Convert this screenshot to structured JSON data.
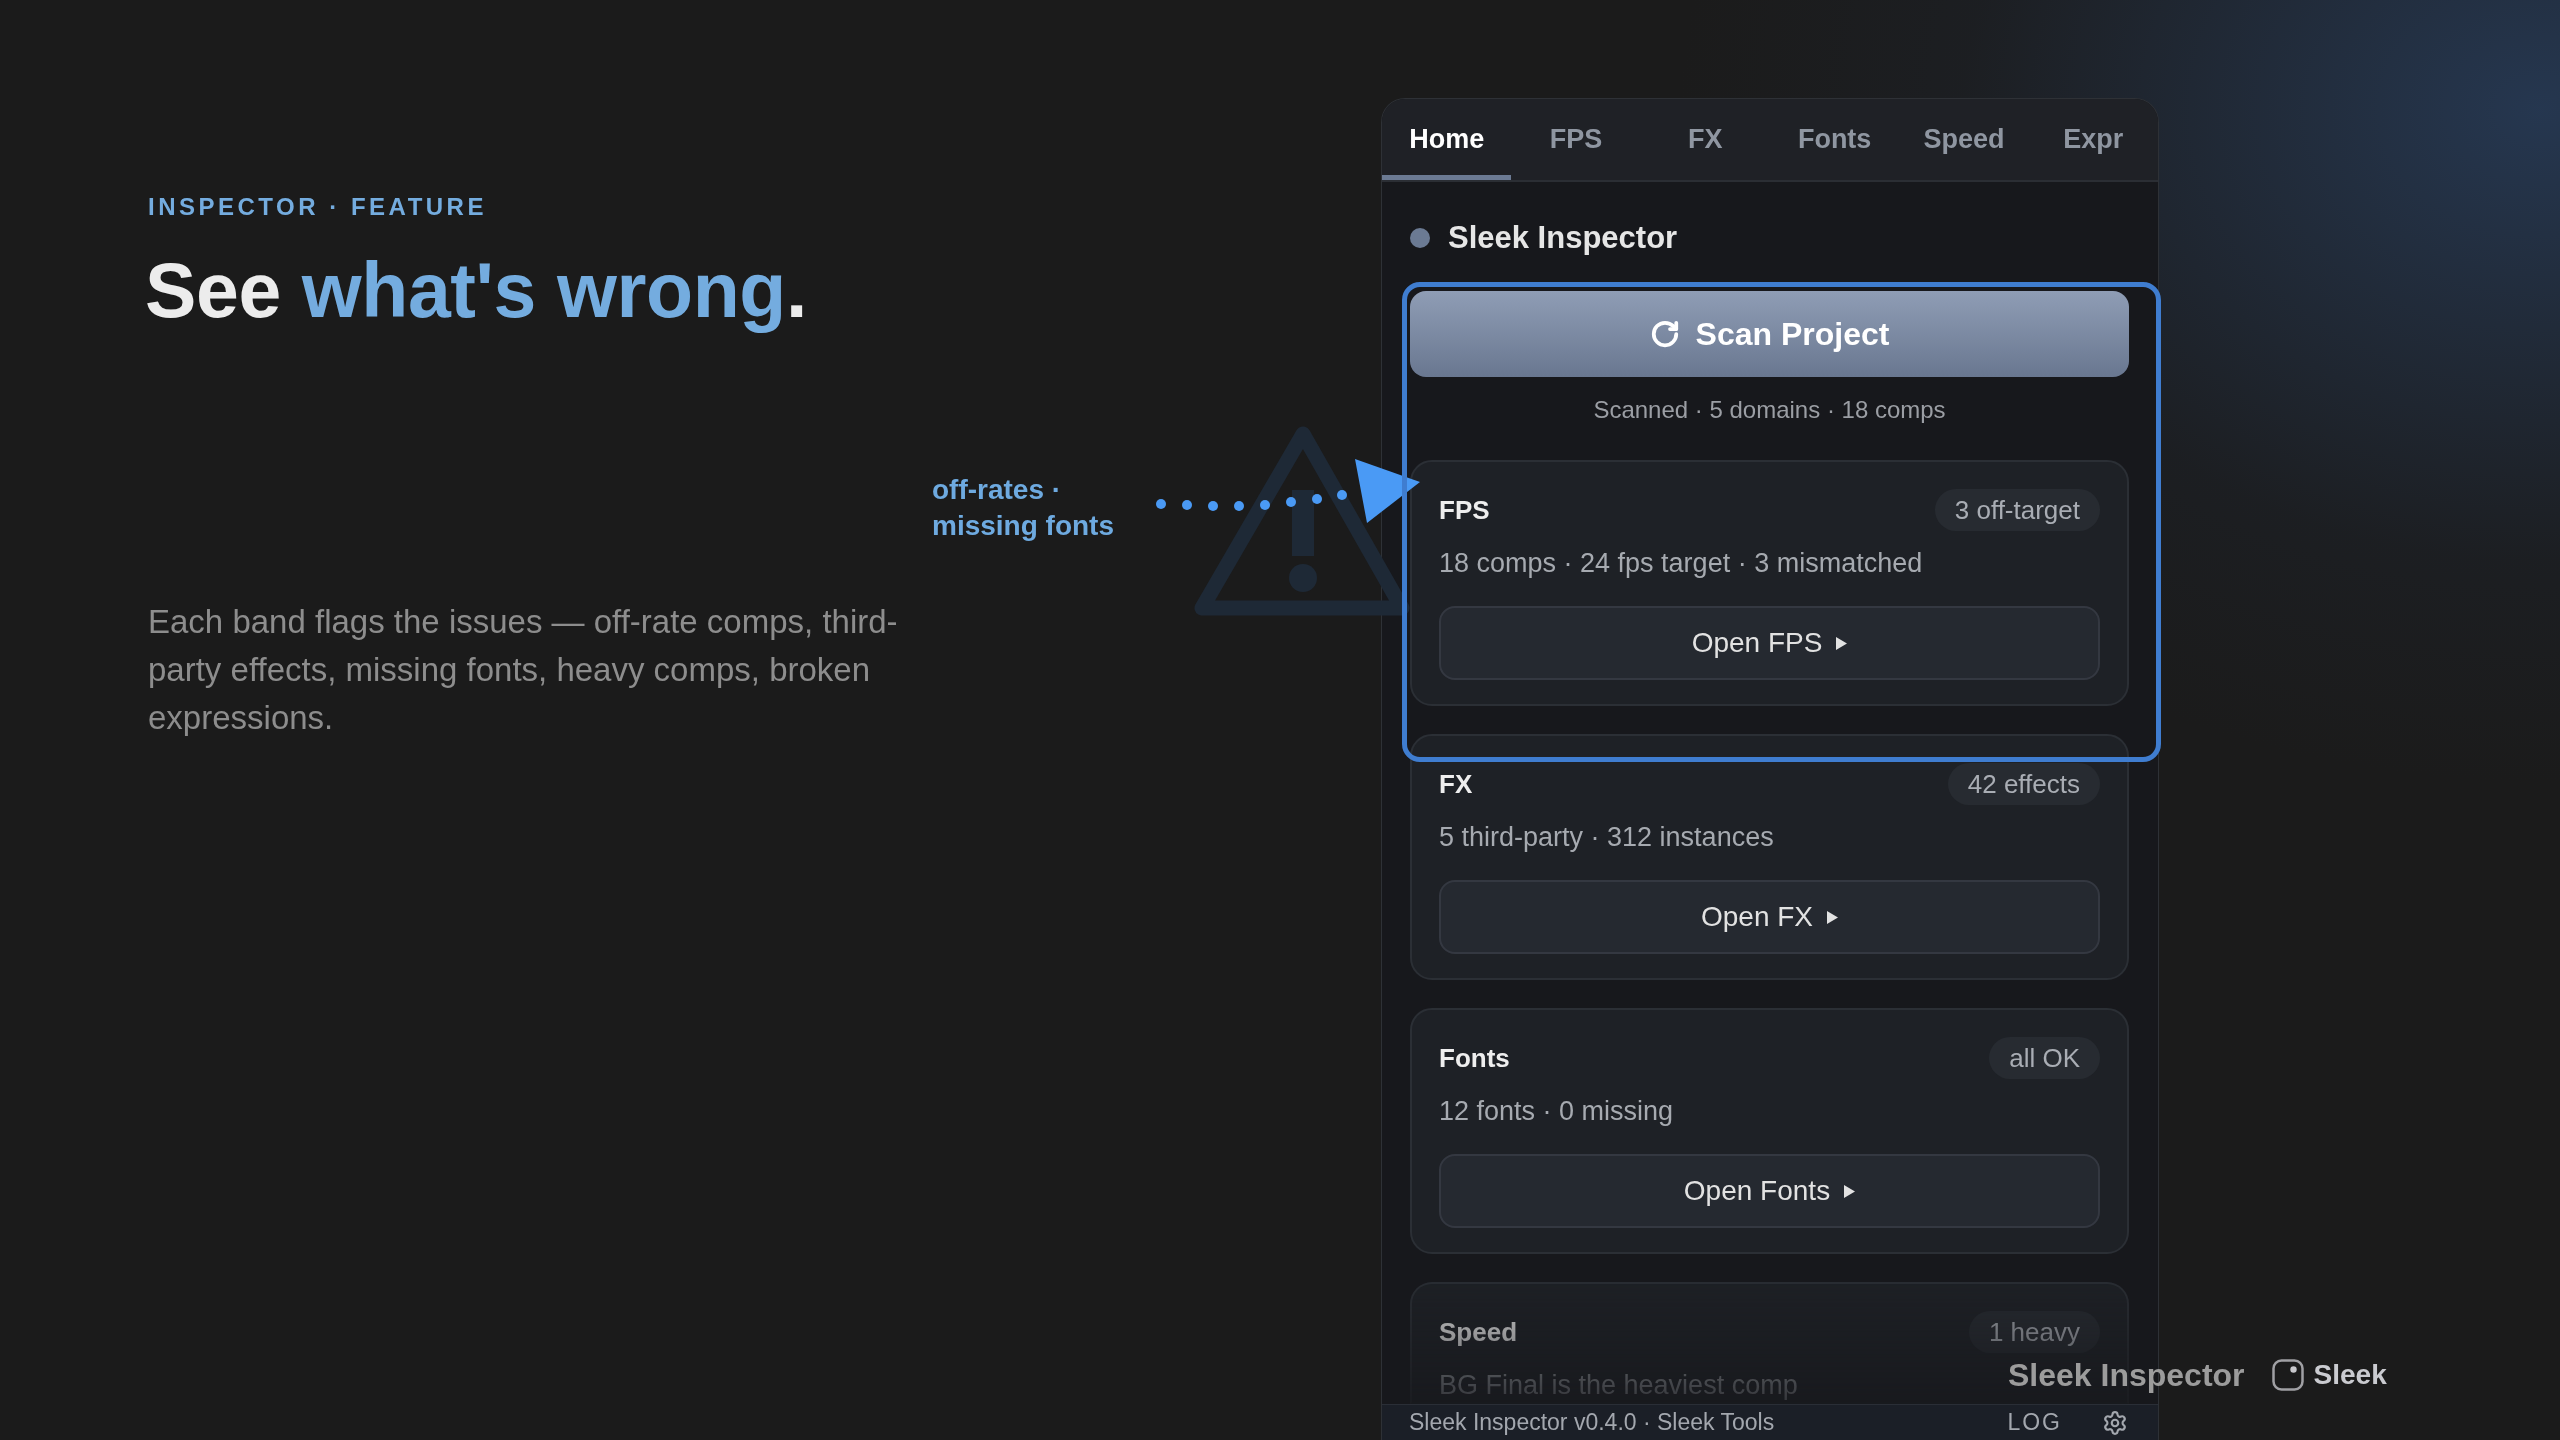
{
  "intro": {
    "eyebrow": "INSPECTOR · FEATURE",
    "headline": [
      {
        "text": "See ",
        "accent": false
      },
      {
        "text": "what's wrong",
        "accent": true
      },
      {
        "text": ".",
        "accent": false
      }
    ],
    "body": "Each band flags the issues — off-rate comps, third-party effects, missing fonts, heavy comps, broken expressions."
  },
  "callout": {
    "text": "off-rates · missing fonts"
  },
  "panel": {
    "tabs": [
      {
        "label": "Home",
        "selected": true
      },
      {
        "label": "FPS",
        "selected": false
      },
      {
        "label": "FX",
        "selected": false
      },
      {
        "label": "Fonts",
        "selected": false
      },
      {
        "label": "Speed",
        "selected": false
      },
      {
        "label": "Expr",
        "selected": false
      }
    ],
    "title": "Sleek Inspector",
    "scan_button": "Scan Project",
    "scan_summary": "Scanned · 5 domains · 18 comps",
    "cards": [
      {
        "title": "FPS",
        "badge": "3 off-target",
        "summary": "18 comps · 24 fps target · 3 mismatched",
        "button": "Open FPS"
      },
      {
        "title": "FX",
        "badge": "42 effects",
        "summary": "5 third-party · 312 instances",
        "button": "Open FX"
      },
      {
        "title": "Fonts",
        "badge": "all OK",
        "summary": "12 fonts · 0 missing",
        "button": "Open Fonts"
      },
      {
        "title": "Speed",
        "badge": "1 heavy",
        "summary": "BG Final is the heaviest comp"
      }
    ],
    "footer": {
      "version": "Sleek Inspector v0.4.0 · Sleek Tools",
      "log_button": "LOG"
    }
  },
  "brand": {
    "product": "Sleek Inspector",
    "logo_text": "Sleek"
  }
}
